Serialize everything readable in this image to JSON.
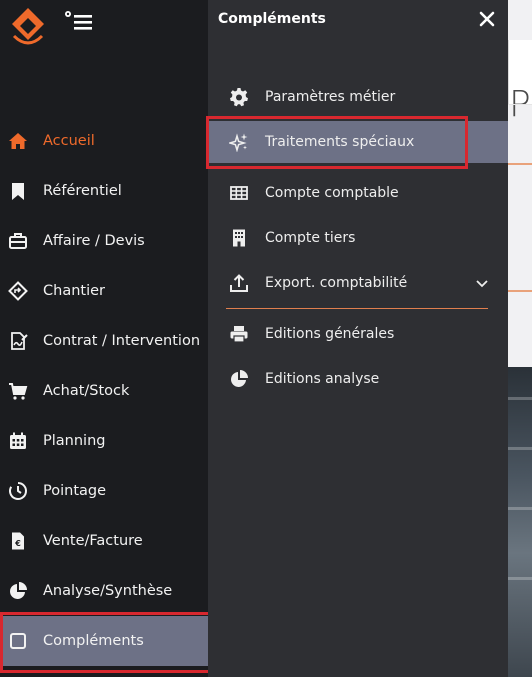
{
  "app": {
    "accent_color": "#ef6a2b",
    "highlight_color": "#6d7186",
    "outline_color": "#d8282f"
  },
  "header": {
    "logo_icon": "brand-logo-icon",
    "settings_menu_icon": "gear-menu-icon"
  },
  "sidebar": {
    "items": [
      {
        "label": "Accueil",
        "icon": "home-icon",
        "state": "active"
      },
      {
        "label": "Référentiel",
        "icon": "bookmark-icon"
      },
      {
        "label": "Affaire / Devis",
        "icon": "briefcase-icon"
      },
      {
        "label": "Chantier",
        "icon": "road-sign-icon"
      },
      {
        "label": "Contrat / Intervention",
        "icon": "contract-icon"
      },
      {
        "label": "Achat/Stock",
        "icon": "cart-icon"
      },
      {
        "label": "Planning",
        "icon": "calendar-icon"
      },
      {
        "label": "Pointage",
        "icon": "timer-icon"
      },
      {
        "label": "Vente/Facture",
        "icon": "invoice-icon"
      },
      {
        "label": "Analyse/Synthèse",
        "icon": "pie-chart-icon"
      },
      {
        "label": "Compléments",
        "icon": "square-icon",
        "state": "selected"
      }
    ]
  },
  "panel": {
    "title": "Compléments",
    "close_icon": "close-icon",
    "items": [
      {
        "label": "Paramètres métier",
        "icon": "gear-icon"
      },
      {
        "label": "Traitements spéciaux",
        "icon": "sparkles-icon",
        "state": "highlighted"
      },
      {
        "label": "Compte comptable",
        "icon": "table-icon"
      },
      {
        "label": "Compte tiers",
        "icon": "building-icon"
      },
      {
        "label": "Export. comptabilité",
        "icon": "upload-icon",
        "expandable": true
      },
      {
        "label": "Editions générales",
        "icon": "printer-icon"
      },
      {
        "label": "Editions analyse",
        "icon": "pie-chart-icon"
      }
    ]
  },
  "background": {
    "title_fragment": "P"
  }
}
